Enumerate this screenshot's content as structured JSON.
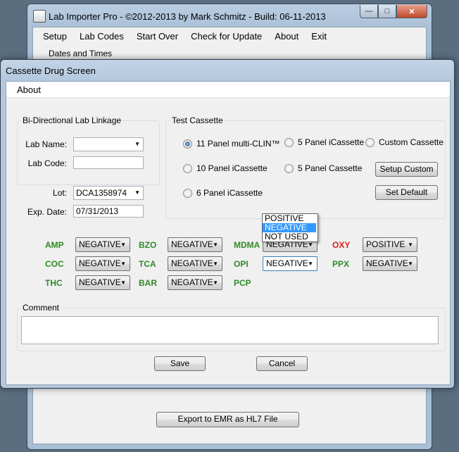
{
  "main_window": {
    "title": "Lab Importer Pro - ©2012-2013 by Mark Schmitz - Build: 06-11-2013",
    "menu": [
      "Setup",
      "Lab Codes",
      "Start Over",
      "Check for Update",
      "About",
      "Exit"
    ],
    "section_label": "Dates and Times",
    "export_button": "Export to EMR as HL7 File"
  },
  "dialog": {
    "title": "Cassette Drug Screen",
    "menu": {
      "about": "About"
    },
    "lab_linkage": {
      "legend": "Bi-Directional Lab Linkage",
      "lab_name_label": "Lab Name:",
      "lab_name_value": "",
      "lab_code_label": "Lab Code:",
      "lab_code_value": ""
    },
    "lot": {
      "label": "Lot:",
      "value": "DCA1358974"
    },
    "exp_date": {
      "label": "Exp. Date:",
      "value": "07/31/2013"
    },
    "test_cassette": {
      "legend": "Test Cassette",
      "options": [
        {
          "label": "11 Panel multi-CLIN™",
          "checked": true
        },
        {
          "label": "5 Panel iCassette",
          "checked": false
        },
        {
          "label": "Custom Cassette",
          "checked": false
        },
        {
          "label": "10 Panel iCassette",
          "checked": false
        },
        {
          "label": "5 Panel Cassette",
          "checked": false
        },
        {
          "label": "6 Panel iCassette",
          "checked": false
        }
      ],
      "setup_custom_button": "Setup Custom",
      "set_default_button": "Set Default"
    },
    "drugs": [
      {
        "code": "AMP",
        "value": "NEGATIVE",
        "color": "#2e8b26"
      },
      {
        "code": "BZO",
        "value": "NEGATIVE",
        "color": "#2e8b26"
      },
      {
        "code": "MDMA",
        "value": "NEGATIVE",
        "color": "#2e8b26"
      },
      {
        "code": "OXY",
        "value": "POSITIVE",
        "color": "#e01b1b"
      },
      {
        "code": "COC",
        "value": "NEGATIVE",
        "color": "#2e8b26"
      },
      {
        "code": "TCA",
        "value": "NEGATIVE",
        "color": "#2e8b26"
      },
      {
        "code": "OPI",
        "value": "NEGATIVE",
        "color": "#2e8b26"
      },
      {
        "code": "PPX",
        "value": "NEGATIVE",
        "color": "#2e8b26"
      },
      {
        "code": "THC",
        "value": "NEGATIVE",
        "color": "#2e8b26"
      },
      {
        "code": "BAR",
        "value": "NEGATIVE",
        "color": "#2e8b26"
      },
      {
        "code": "PCP",
        "value": "",
        "color": "#2e8b26"
      }
    ],
    "open_dropdown": {
      "options": [
        "POSITIVE",
        "NEGATIVE",
        "NOT USED"
      ],
      "selected": "NEGATIVE"
    },
    "comment": {
      "legend": "Comment",
      "value": ""
    },
    "save_button": "Save",
    "cancel_button": "Cancel"
  }
}
